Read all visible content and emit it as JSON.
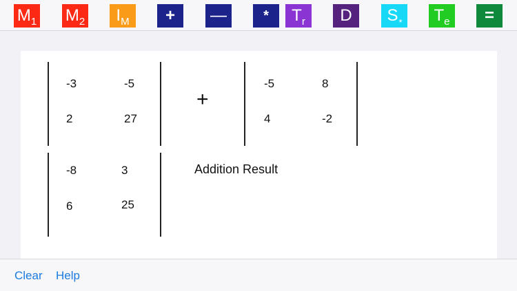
{
  "toolbar": {
    "m1": {
      "main": "M",
      "sub": "1",
      "color": "#fc2a14"
    },
    "m2": {
      "main": "M",
      "sub": "2",
      "color": "#fc2a14"
    },
    "im": {
      "main": "I",
      "sub": "M",
      "color": "#fb9b1a"
    },
    "add": {
      "main": "+",
      "color": "#1c248c"
    },
    "subtract": {
      "main": "—",
      "color": "#1c248c"
    },
    "multiply": {
      "main": "*",
      "color": "#1c248c"
    },
    "transpose": {
      "main": "T",
      "sub": "r",
      "color": "#8a34d4"
    },
    "determinant": {
      "main": "D",
      "color": "#55237e"
    },
    "scalar": {
      "main": "S",
      "sub": "*",
      "color": "#18d8f8"
    },
    "exponent": {
      "main": "T",
      "sub": "e",
      "color": "#22cc22"
    },
    "equals": {
      "main": "=",
      "color": "#0f8a3c"
    }
  },
  "matrix1": {
    "r1c1": "-3",
    "r1c2": "-5",
    "r2c1": "2",
    "r2c2": "27"
  },
  "operator": "+",
  "matrix2": {
    "r1c1": "-5",
    "r1c2": "8",
    "r2c1": "4",
    "r2c2": "-2"
  },
  "result": {
    "r1c1": "-8",
    "r1c2": "3",
    "r2c1": "6",
    "r2c2": "25"
  },
  "result_label": "Addition Result",
  "footer": {
    "clear": "Clear",
    "help": "Help"
  }
}
